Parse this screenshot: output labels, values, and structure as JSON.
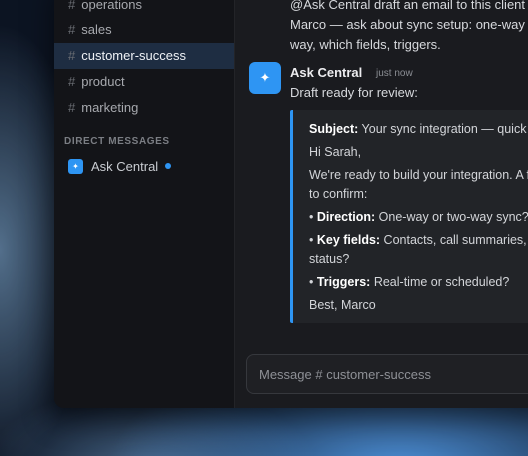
{
  "sidebar": {
    "channels": [
      {
        "name": "operations",
        "active": false
      },
      {
        "name": "sales",
        "active": false
      },
      {
        "name": "customer-success",
        "active": true
      },
      {
        "name": "product",
        "active": false
      },
      {
        "name": "marketing",
        "active": false
      }
    ],
    "hash_symbol": "#",
    "direct_messages_title": "DIRECT MESSAGES",
    "dm": {
      "label": "Ask Central",
      "icon": "sparkle-icon",
      "status": "online"
    }
  },
  "conversation": {
    "previous_message_lines": [
      "@Ask Central draft an email to this client",
      "Marco — ask about sync setup: one-way or two-",
      "way, which fields, triggers."
    ],
    "reply": {
      "sender": "Ask Central",
      "timestamp": "just now",
      "avatar_icon": "sparkle-icon",
      "text": "Draft ready for review:"
    },
    "draft": {
      "subject_label": "Subject:",
      "subject_text": " Your sync integration — quick questions",
      "greeting": "Hi Sarah,",
      "intro_lines": [
        "We're ready to build your integration. A few things",
        "to confirm:"
      ],
      "bullets": [
        {
          "label": "Direction:",
          "text": " One-way or two-way sync?",
          "continuation": ""
        },
        {
          "label": "Key fields:",
          "text": " Contacts, call summaries, deal",
          "continuation": "status?"
        },
        {
          "label": "Triggers:",
          "text": " Real-time or scheduled?",
          "continuation": ""
        }
      ],
      "signoff": "Best, Marco"
    }
  },
  "composer": {
    "placeholder": "Message # customer-success"
  },
  "colors": {
    "accent": "#2e95f3",
    "sidebar_bg": "#131418",
    "main_bg": "#1a1b1f",
    "active_channel_bg": "#1e2d42"
  }
}
